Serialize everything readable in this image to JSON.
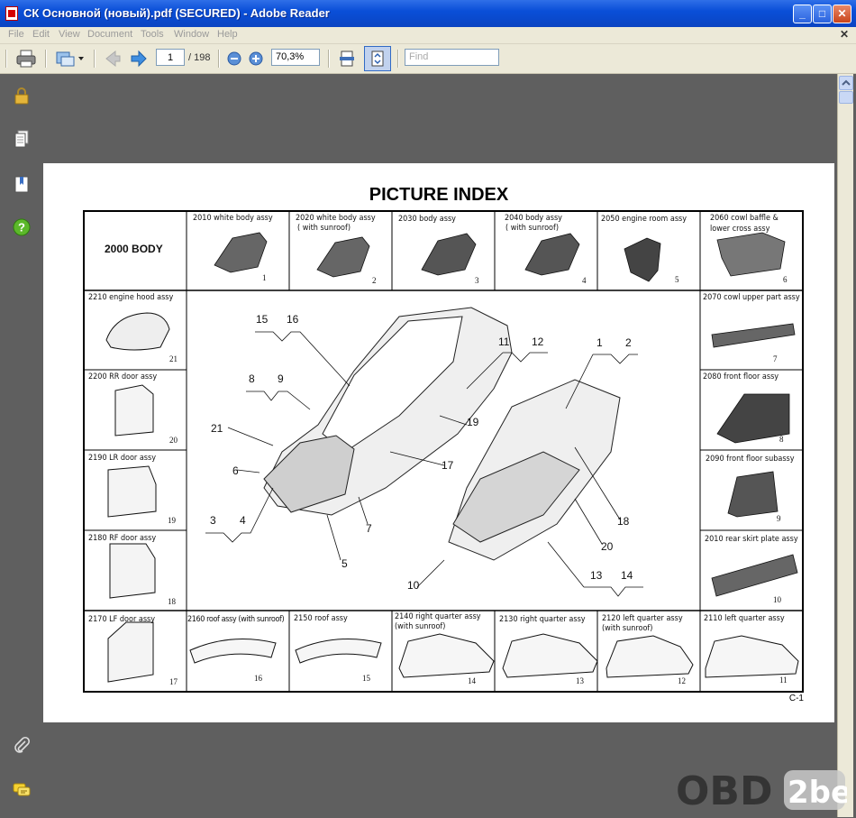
{
  "window": {
    "title": "СК Основной (новый).pdf (SECURED) - Adobe Reader"
  },
  "menu": [
    "File",
    "Edit",
    "View",
    "Document",
    "Tools",
    "Window",
    "Help"
  ],
  "toolbar": {
    "page_current": "1",
    "page_total": "/ 198",
    "zoom": "70,3%",
    "find_placeholder": "Find"
  },
  "document": {
    "title": "PICTURE INDEX",
    "page_code": "C-1",
    "header_label": "2000 BODY",
    "top_row": [
      {
        "label": "2010 white body assy",
        "label2": "",
        "num": "1"
      },
      {
        "label": "2020 white body assy",
        "label2": "( with sunroof)",
        "num": "2"
      },
      {
        "label": "2030 body assy",
        "label2": "",
        "num": "3"
      },
      {
        "label": "2040 body assy",
        "label2": "( with sunroof)",
        "num": "4"
      },
      {
        "label": "2050 engine room assy",
        "label2": "",
        "num": "5"
      },
      {
        "label": "2060 cowl baffle &",
        "label2": "lower cross assy",
        "num": "6"
      }
    ],
    "left_col": [
      {
        "label": "2210 engine hood assy",
        "num": "21"
      },
      {
        "label": "2200 RR door assy",
        "num": "20"
      },
      {
        "label": "2190 LR door assy",
        "num": "19"
      },
      {
        "label": "2180 RF door assy",
        "num": "18"
      }
    ],
    "right_col": [
      {
        "label": "2070 cowl upper part assy",
        "num": "7"
      },
      {
        "label": "2080 front floor assy",
        "num": "8"
      },
      {
        "label": "2090  front floor subassy",
        "num": "9"
      },
      {
        "label": "2010 rear skirt plate assy",
        "num": "10"
      }
    ],
    "bottom_row": [
      {
        "label": "2170 LF door assy",
        "label2": "",
        "num": "17"
      },
      {
        "label": "2160 roof assy (with sunroof)",
        "label2": "",
        "num": "16"
      },
      {
        "label": "2150 roof assy",
        "label2": "",
        "num": "15"
      },
      {
        "label": "2140 right quarter assy",
        "label2": "(with sunroof)",
        "num": "14"
      },
      {
        "label": "2130 right quarter assy",
        "label2": "",
        "num": "13"
      },
      {
        "label": "2120 left quarter assy",
        "label2": "(with sunroof)",
        "num": "12"
      },
      {
        "label": "2110 left quarter assy",
        "label2": "",
        "num": "11"
      }
    ],
    "callouts": [
      "15",
      "16",
      "8",
      "9",
      "21",
      "6",
      "3",
      "4",
      "5",
      "7",
      "17",
      "19",
      "11",
      "12",
      "1",
      "2",
      "18",
      "20",
      "10",
      "13",
      "14"
    ]
  },
  "watermark": {
    "text1": "OBD",
    "text2": "2be"
  },
  "icons": [
    "lock-icon",
    "pages-icon",
    "bookmarks-icon",
    "help-icon",
    "attachment-icon",
    "comments-icon"
  ],
  "colors": {
    "titlebar": "#0a4fd8",
    "workspace": "#5f5f5f",
    "chrome": "#ece9d8"
  }
}
